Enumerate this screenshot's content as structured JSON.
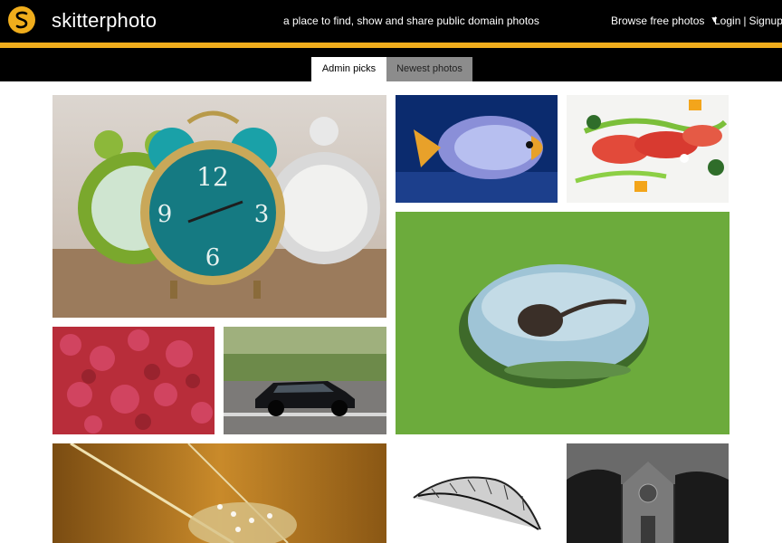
{
  "header": {
    "brand": "skitterphoto",
    "tagline": "a place to find, show and share public domain photos",
    "browse_label": "Browse free photos",
    "login_label": "Login",
    "separator": "|",
    "signup_label": "Signup"
  },
  "tabs": [
    {
      "label": "Admin picks",
      "active": true
    },
    {
      "label": "Newest photos",
      "active": false
    }
  ],
  "colors": {
    "accent": "#f0ad1c",
    "header_bg": "#000000",
    "inactive_tab": "#8c8c8c"
  },
  "icons": {
    "logo": "skitterphoto-logo-icon",
    "dropdown": "caret-down-icon"
  },
  "gallery": {
    "photos": [
      {
        "subject": "alarm-clocks"
      },
      {
        "subject": "fish"
      },
      {
        "subject": "food-plate"
      },
      {
        "subject": "tadpole-in-water-drop"
      },
      {
        "subject": "red-texture"
      },
      {
        "subject": "car"
      },
      {
        "subject": "grass-dewdrops"
      },
      {
        "subject": "feather-drawing"
      },
      {
        "subject": "chapel"
      }
    ]
  }
}
